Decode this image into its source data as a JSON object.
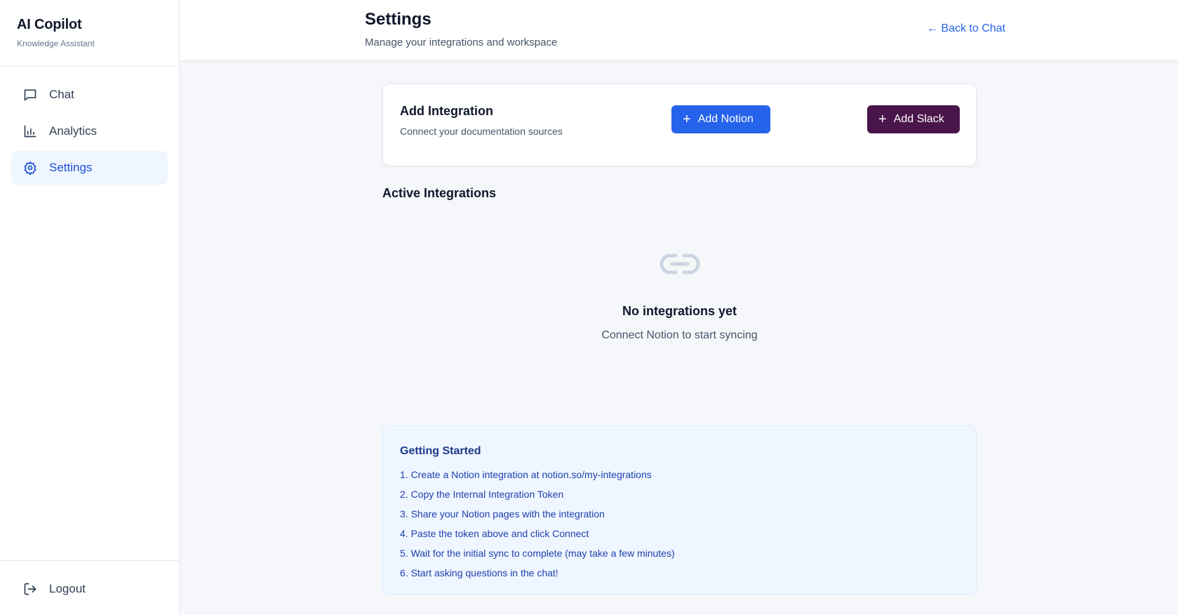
{
  "sidebar": {
    "brand_title": "AI Copilot",
    "brand_subtitle": "Knowledge Assistant",
    "items": [
      {
        "label": "Chat",
        "icon": "chat-icon",
        "active": false
      },
      {
        "label": "Analytics",
        "icon": "bar-chart-icon",
        "active": false
      },
      {
        "label": "Settings",
        "icon": "gear-icon",
        "active": true
      }
    ],
    "logout_label": "Logout"
  },
  "header": {
    "title": "Settings",
    "subtitle": "Manage your integrations and workspace",
    "back_label": "← Back to Chat"
  },
  "add_integration": {
    "title": "Add Integration",
    "subtitle": "Connect your documentation sources",
    "notion_label": "Add Notion",
    "slack_label": "Add Slack"
  },
  "active": {
    "title": "Active Integrations",
    "empty_title": "No integrations yet",
    "empty_subtitle": "Connect Notion to start syncing",
    "empty_icon": "link-icon"
  },
  "guide": {
    "title": "Getting Started",
    "steps": [
      "1. Create a Notion integration at notion.so/my-integrations",
      "2. Copy the Internal Integration Token",
      "3. Share your Notion pages with the integration",
      "4. Paste the token above and click Connect",
      "5. Wait for the initial sync to complete (may take a few minutes)",
      "6. Start asking questions in the chat!"
    ]
  },
  "colors": {
    "accent": "#2563eb",
    "slack": "#4a154b",
    "active_bg": "#eff6ff"
  }
}
